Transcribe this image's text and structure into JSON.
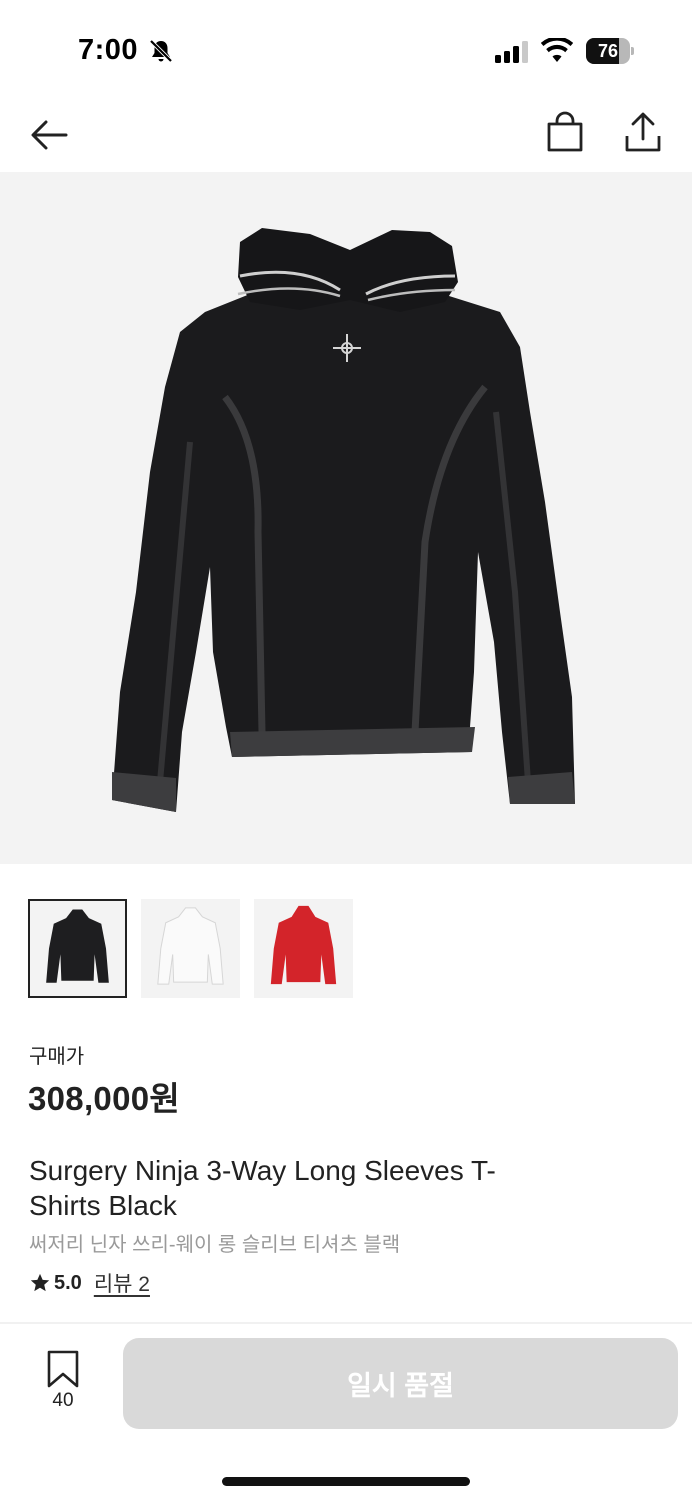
{
  "status_bar": {
    "time": "7:00",
    "battery_level": "76",
    "battery_fraction": 0.76,
    "icons": [
      "bell-slash-icon",
      "signal-icon",
      "wifi-icon",
      "battery-icon"
    ]
  },
  "nav": {
    "icons": [
      "back-arrow-icon",
      "shopping-bag-icon",
      "share-icon"
    ]
  },
  "product": {
    "price_label": "구매가",
    "price": "308,000원",
    "title_en": "Surgery Ninja 3-Way Long Sleeves T-Shirts Black",
    "title_ko": "써저리 닌자 쓰리-웨이 롱 슬리브 티셔츠 블랙",
    "rating": "5.0",
    "review_link": "리뷰 2",
    "thumbnails": [
      {
        "color": "black",
        "hex": "#1e1e20",
        "selected": true
      },
      {
        "color": "white",
        "hex": "#fafafa",
        "selected": false
      },
      {
        "color": "red",
        "hex": "#d3242a",
        "selected": false
      }
    ]
  },
  "bottom_bar": {
    "bookmark_count": "40",
    "buy_button": "일시 품절"
  },
  "colors": {
    "hero_bg": "#f3f3f3",
    "sold_out_button": "#d9d9d9",
    "text_primary": "#222222",
    "text_secondary": "#9a9a9a"
  }
}
